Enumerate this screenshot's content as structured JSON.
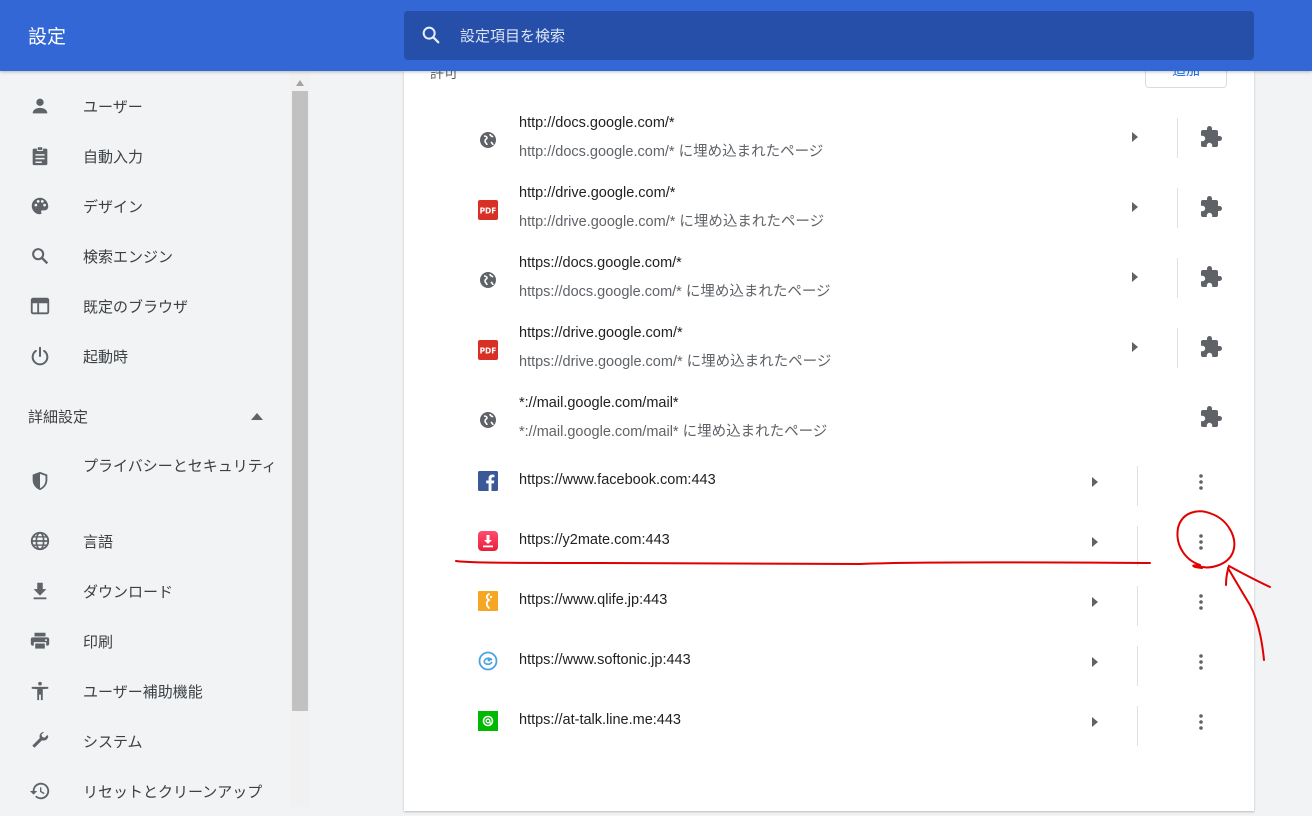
{
  "header": {
    "title": "設定",
    "search_placeholder": "設定項目を検索"
  },
  "sidebar": {
    "items": [
      {
        "label": "ユーザー",
        "icon": "person-icon"
      },
      {
        "label": "自動入力",
        "icon": "clipboard-icon"
      },
      {
        "label": "デザイン",
        "icon": "palette-icon"
      },
      {
        "label": "検索エンジン",
        "icon": "search-icon"
      },
      {
        "label": "既定のブラウザ",
        "icon": "browser-window-icon"
      },
      {
        "label": "起動時",
        "icon": "power-icon"
      }
    ],
    "advanced_heading": "詳細設定",
    "advanced_items": [
      {
        "label": "プライバシーとセキュリティ",
        "icon": "shield-icon"
      },
      {
        "label": "言語",
        "icon": "globe-icon"
      },
      {
        "label": "ダウンロード",
        "icon": "download-icon"
      },
      {
        "label": "印刷",
        "icon": "printer-icon"
      },
      {
        "label": "ユーザー補助機能",
        "icon": "accessibility-icon"
      },
      {
        "label": "システム",
        "icon": "wrench-icon"
      },
      {
        "label": "リセットとクリーンアップ",
        "icon": "restore-icon"
      }
    ]
  },
  "main": {
    "section_label": "許可",
    "add_button": "追加",
    "extension_rows": [
      {
        "title": "http://docs.google.com/*",
        "subtitle": "http://docs.google.com/* に埋め込まれたページ",
        "icon": "globe-icon"
      },
      {
        "title": "http://drive.google.com/*",
        "subtitle": "http://drive.google.com/* に埋め込まれたページ",
        "icon": "pdf-icon"
      },
      {
        "title": "https://docs.google.com/*",
        "subtitle": "https://docs.google.com/* に埋め込まれたページ",
        "icon": "globe-icon"
      },
      {
        "title": "https://drive.google.com/*",
        "subtitle": "https://drive.google.com/* に埋め込まれたページ",
        "icon": "pdf-icon"
      },
      {
        "title": "*://mail.google.com/mail*",
        "subtitle": "*://mail.google.com/mail* に埋め込まれたページ",
        "icon": "globe-icon"
      }
    ],
    "site_rows": [
      {
        "title": "https://www.facebook.com:443",
        "icon": "facebook-icon"
      },
      {
        "title": "https://y2mate.com:443",
        "icon": "y2mate-download-icon"
      },
      {
        "title": "https://www.qlife.jp:443",
        "icon": "qlife-icon"
      },
      {
        "title": "https://www.softonic.jp:443",
        "icon": "softonic-icon"
      },
      {
        "title": "https://at-talk.line.me:443",
        "icon": "line-at-icon"
      }
    ]
  },
  "colors": {
    "header_bg": "#3367d6",
    "search_bg": "#254fa8",
    "annotation": "#e00000"
  }
}
